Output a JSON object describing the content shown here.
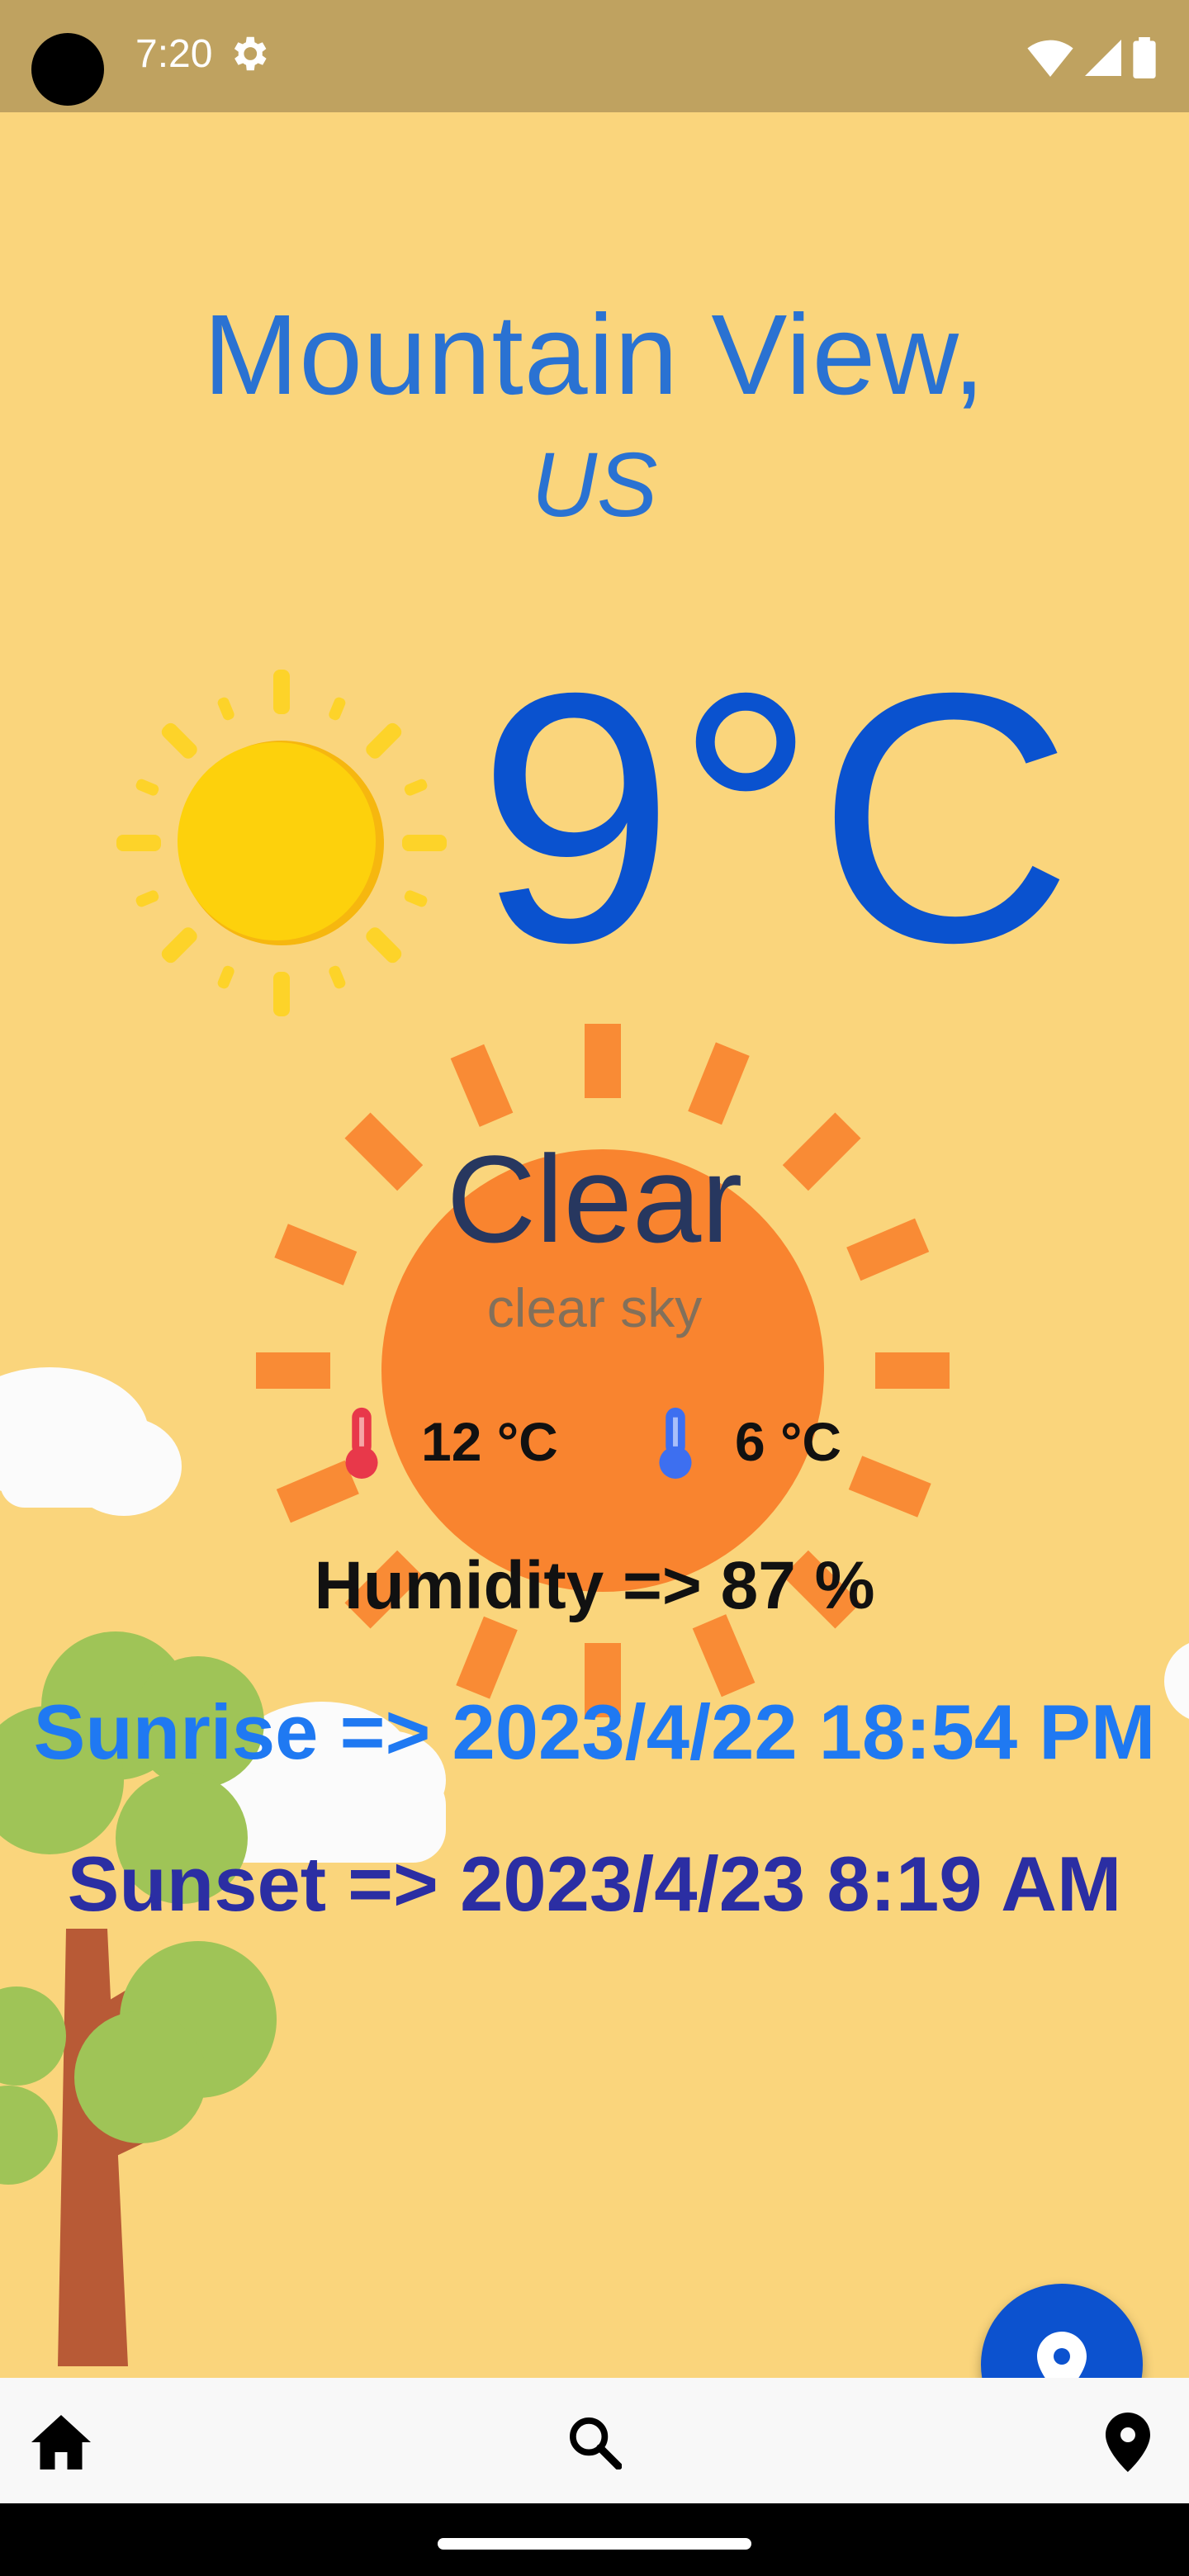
{
  "status_bar": {
    "time": "7:20"
  },
  "location": {
    "city": "Mountain View,",
    "country": "US"
  },
  "weather": {
    "temperature": "9°C",
    "main": "Clear",
    "description": "clear sky",
    "temp_max": "12 °C",
    "temp_min": "6 °C",
    "humidity": "Humidity => 87 %",
    "sunrise": "Sunrise => 2023/4/22 18:54 PM",
    "sunset": "Sunset => 2023/4/23 8:19 AM"
  },
  "icons": {
    "weather_icon": "sun-icon",
    "max_temp_icon": "thermometer-hot-icon",
    "min_temp_icon": "thermometer-cold-icon",
    "fab": "location-pin-icon",
    "nav": [
      "home-icon",
      "search-icon",
      "location-pin-icon"
    ]
  },
  "colors": {
    "background": "#fad57c",
    "city": "#2a72d2",
    "temperature": "#0a52cf",
    "sunrise": "#1f79f2",
    "sunset": "#2b2ea3",
    "fab": "#0c52cf"
  }
}
